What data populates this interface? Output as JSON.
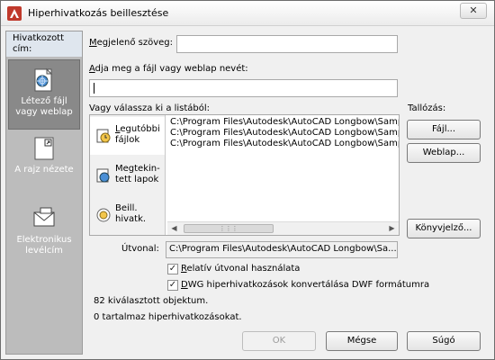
{
  "window": {
    "title": "Hiperhivatkozás beillesztése",
    "close_label": "✕",
    "accent": "#c0392b"
  },
  "sidebar": {
    "header": "Hivatkozott cím:",
    "items": [
      {
        "label": "Létező fájl vagy weblap",
        "icon": "globe-document-icon",
        "active": true
      },
      {
        "label": "A rajz nézete",
        "icon": "drawing-view-icon",
        "active": false
      },
      {
        "label": "Elektronikus levélcím",
        "icon": "envelope-icon",
        "active": false
      }
    ]
  },
  "form": {
    "display_text_label": "Megjelenő szöveg:",
    "display_text_value": "",
    "file_label": "Adja meg a fájl vagy weblap nevét:",
    "file_value": "",
    "list_label": "Vagy válassza ki a listából:",
    "browse_label": "Tallózás:",
    "file_button": "Fájl...",
    "web_button": "Weblap...",
    "bookmark_button": "Könyvjelző...",
    "list_tabs": [
      {
        "label": "Legutóbbi fájlok",
        "icon": "recent-files-icon"
      },
      {
        "label": "Megtekin-tett lapok",
        "icon": "browsed-pages-icon"
      },
      {
        "label": "Beill. hivatk.",
        "icon": "inserted-links-icon"
      }
    ],
    "list_items": [
      "C:\\Program Files\\Autodesk\\AutoCAD Longbow\\Samp",
      "C:\\Program Files\\Autodesk\\AutoCAD Longbow\\Samp",
      "C:\\Program Files\\Autodesk\\AutoCAD Longbow\\Samp"
    ],
    "path_label": "Útvonal:",
    "path_value": "C:\\Program Files\\Autodesk\\AutoCAD Longbow\\Sa...",
    "relative_path_label": "Relatív útvonal használata",
    "relative_path_checked": true,
    "convert_dwg_label": "DWG hiperhivatkozások konvertálása DWF formátumra",
    "convert_dwg_checked": true,
    "status_selected": "82 kiválasztott objektum.",
    "status_contains": "0 tartalmaz hiperhivatkozásokat."
  },
  "buttons": {
    "ok": "OK",
    "cancel": "Mégse",
    "help": "Súgó"
  }
}
